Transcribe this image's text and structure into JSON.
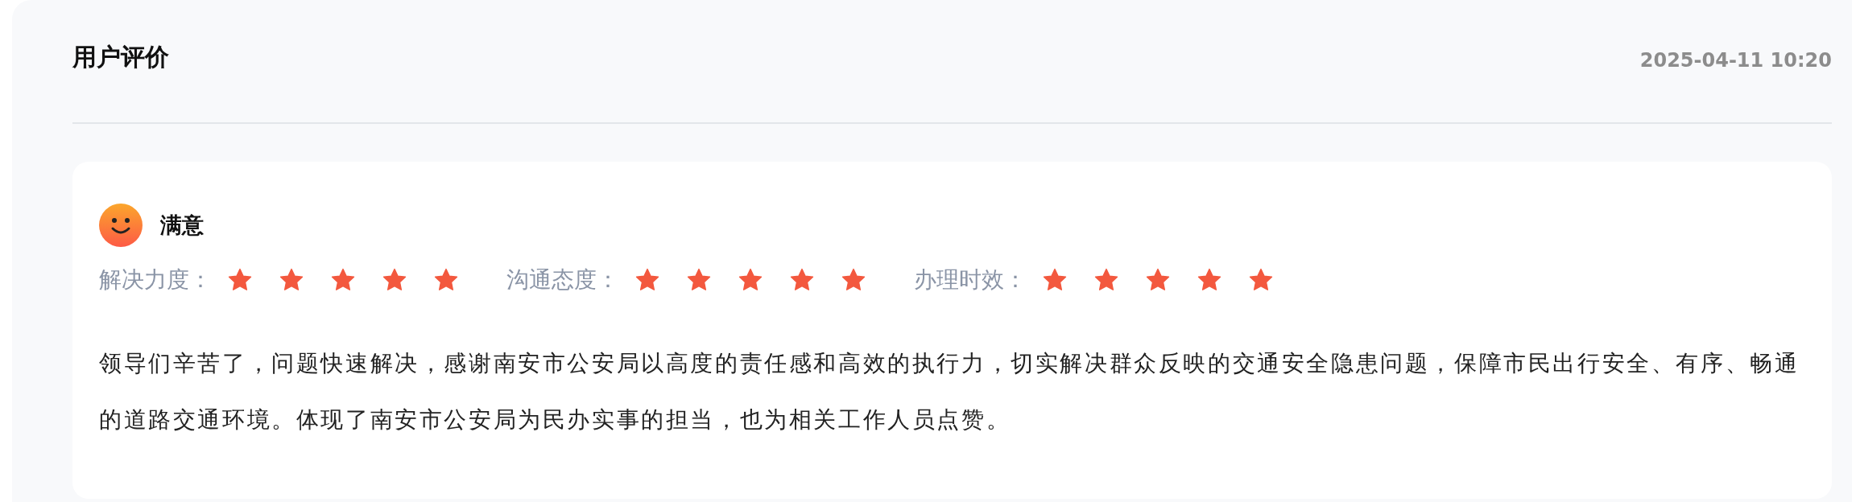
{
  "header": {
    "title": "用户评价",
    "date": "2025-04-11 10:20"
  },
  "review": {
    "mood": "满意",
    "ratings": [
      {
        "label": "解决力度：",
        "stars": 5
      },
      {
        "label": "沟通态度：",
        "stars": 5
      },
      {
        "label": "办理时效：",
        "stars": 5
      }
    ],
    "comment": "领导们辛苦了，问题快速解决，感谢南安市公安局以高度的责任感和高效的执行力，切实解决群众反映的交通安全隐患问题，保障市民出行安全、有序、畅通的道路交通环境。体现了南安市公安局为民办实事的担当，也为相关工作人员点赞。"
  }
}
